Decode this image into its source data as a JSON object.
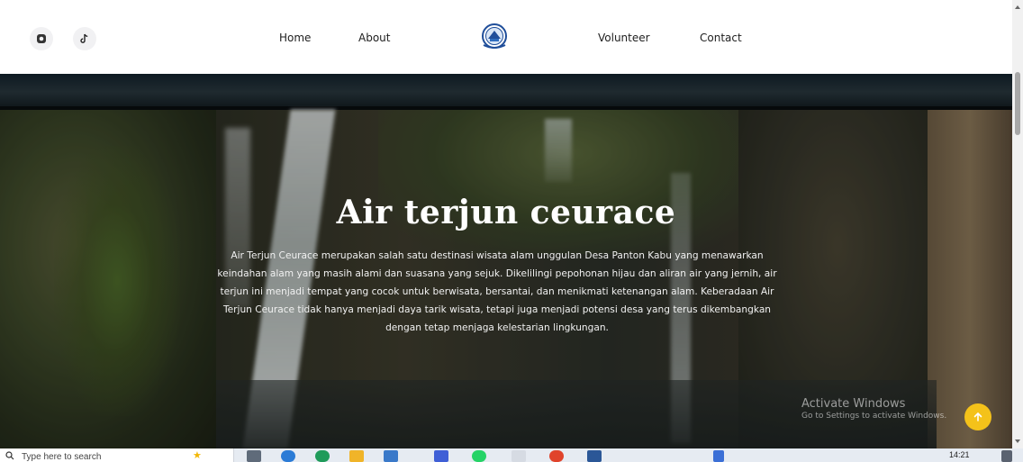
{
  "nav": {
    "links": [
      "Home",
      "About",
      "Volunteer",
      "Contact"
    ]
  },
  "hero": {
    "title": "Air terjun ceurace",
    "description": "Air Terjun Ceurace merupakan salah satu destinasi wisata alam unggulan Desa Panton Kabu yang menawarkan keindahan alam yang masih alami dan suasana yang sejuk. Dikelilingi pepohonan hijau dan aliran air yang jernih, air terjun ini menjadi tempat yang cocok untuk berwisata, bersantai, dan menikmati ketenangan alam. Keberadaan Air Terjun Ceurace tidak hanya menjadi daya tarik wisata, tetapi juga menjadi potensi desa yang terus dikembangkan dengan tetap menjaga kelestarian lingkungan."
  },
  "watermark": {
    "title": "Activate Windows",
    "subtitle": "Go to Settings to activate Windows."
  },
  "taskbar": {
    "search_placeholder": "Type here to search",
    "time": "14:21"
  },
  "colors": {
    "accent_yellow": "#f4c21a",
    "nav_text": "#1e1e1e"
  },
  "icons": [
    "instagram-icon",
    "tiktok-icon",
    "village-logo",
    "arrow-up-icon"
  ]
}
